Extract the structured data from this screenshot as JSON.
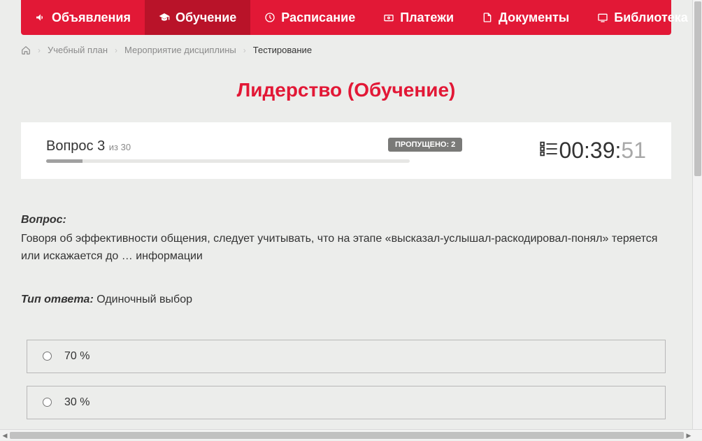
{
  "nav": {
    "items": [
      {
        "label": "Объявления",
        "active": false,
        "icon": "megaphone-icon"
      },
      {
        "label": "Обучение",
        "active": true,
        "icon": "graduation-cap-icon"
      },
      {
        "label": "Расписание",
        "active": false,
        "icon": "clock-icon"
      },
      {
        "label": "Платежи",
        "active": false,
        "icon": "currency-icon"
      },
      {
        "label": "Документы",
        "active": false,
        "icon": "file-icon"
      },
      {
        "label": "Библиотека",
        "active": false,
        "icon": "tv-icon",
        "hasDropdown": true
      }
    ]
  },
  "breadcrumb": {
    "items": [
      {
        "label": "Учебный план"
      },
      {
        "label": "Мероприятие дисциплины"
      }
    ],
    "current": "Тестирование"
  },
  "pageTitle": "Лидерство (Обучение)",
  "quiz": {
    "questionLabel": "Вопрос 3",
    "ofTotal": "из 30",
    "progressPercent": 10,
    "skippedBadge": "ПРОПУЩЕНО: 2",
    "timer": {
      "mmss": "00:39:",
      "sec": "51"
    },
    "questionHeading": "Вопрос:",
    "questionText": "Говоря об эффективности общения, следует учитывать, что на этапе «высказал-услышал-раскодировал-понял» теряется или искажается до … информации",
    "answerTypeLabel": "Тип ответа:",
    "answerTypeValue": "Одиночный выбор",
    "answers": [
      {
        "text": "70 %"
      },
      {
        "text": "30 %"
      }
    ]
  }
}
